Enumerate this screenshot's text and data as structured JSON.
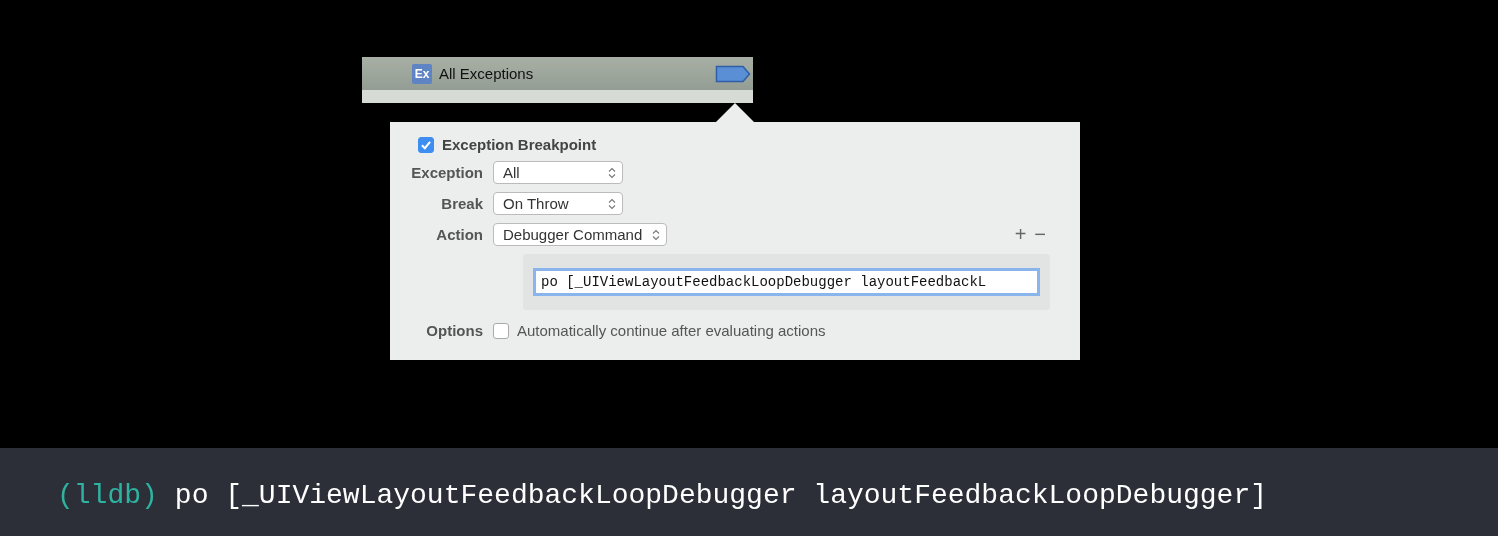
{
  "breakpoint_row": {
    "icon_text": "Ex",
    "title": "All Exceptions",
    "enabled": true
  },
  "popover": {
    "header": {
      "label": "Exception Breakpoint",
      "checked": true
    },
    "settings": [
      {
        "label": "Exception",
        "value": "All"
      },
      {
        "label": "Break",
        "value": "On Throw"
      },
      {
        "label": "Action",
        "value": "Debugger Command"
      }
    ],
    "action_buttons": [
      "+",
      "−"
    ],
    "command": {
      "value": "po [_UIViewLayoutFeedbackLoopDebugger layoutFeedbackL"
    },
    "options": {
      "label": "Options",
      "checkbox": {
        "label": "Automatically continue after evaluating actions",
        "checked": false
      }
    }
  },
  "console": {
    "prompt": "(lldb)",
    "command": "po [_UIViewLayoutFeedbackLoopDebugger layoutFeedbackLoopDebugger]"
  }
}
